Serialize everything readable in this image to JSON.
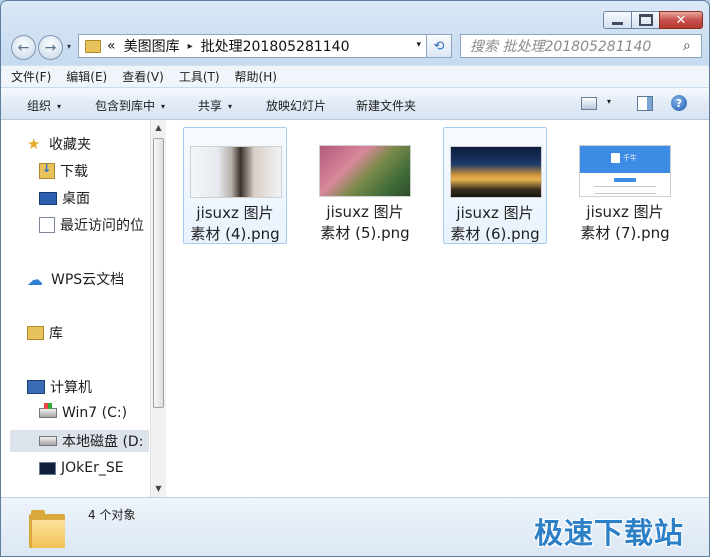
{
  "window": {
    "caption": {
      "minimize": "",
      "maximize": "",
      "close": "✕"
    }
  },
  "nav": {
    "back_glyph": "←",
    "forward_glyph": "→",
    "address_prefix": "«",
    "address_crumbs": [
      "美图图库",
      "批处理201805281140"
    ],
    "address_separator": "▸",
    "dropdown_glyph": "▾",
    "refresh_glyph": "⟲",
    "search_placeholder": "搜索 批处理201805281140",
    "search_glyph": "⌕"
  },
  "menubar": {
    "items": [
      "文件(F)",
      "编辑(E)",
      "查看(V)",
      "工具(T)",
      "帮助(H)"
    ]
  },
  "toolbar": {
    "organize": "组织",
    "include_in_library": "包含到库中",
    "share": "共享",
    "slideshow": "放映幻灯片",
    "new_folder": "新建文件夹",
    "arrow": "▾",
    "help": "?"
  },
  "navpane": {
    "favorites": "收藏夹",
    "downloads": "下载",
    "desktop": "桌面",
    "recent": "最近访问的位",
    "wps_cloud": "WPS云文档",
    "library": "库",
    "computer": "计算机",
    "drive_c": "Win7 (C:)",
    "drive_d": "本地磁盘 (D:",
    "drive_joker": "JOkEr_SE",
    "star_glyph": "★",
    "cloud_glyph": "☁"
  },
  "scrollbar": {
    "up": "▲",
    "down": "▼"
  },
  "files": [
    {
      "line1": "jisuxz 图片",
      "line2": "素材 (4).png",
      "thumb": "portrait",
      "selected": true
    },
    {
      "line1": "jisuxz 图片",
      "line2": "素材 (5).png",
      "thumb": "flowers",
      "selected": false
    },
    {
      "line1": "jisuxz 图片",
      "line2": "素材 (6).png",
      "thumb": "night-city",
      "selected": true
    },
    {
      "line1": "jisuxz 图片",
      "line2": "素材 (7).png",
      "thumb": "app-screenshot",
      "selected": false
    }
  ],
  "thumb_app_logo_text": "千牛",
  "status": {
    "count_text": "4 个对象"
  },
  "watermark": "极速下载站",
  "colors": {
    "accent": "#2d7fc6",
    "selection_border": "#a7cdf0"
  }
}
